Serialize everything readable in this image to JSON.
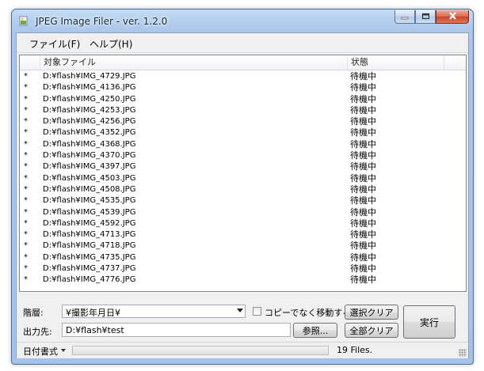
{
  "window": {
    "title": "JPEG Image Filer - ver. 1.2.0"
  },
  "menu": {
    "file": "ファイル(F)",
    "help": "ヘルプ(H)"
  },
  "list": {
    "columns": [
      "対象ファイル",
      "状態"
    ],
    "rows": [
      {
        "mark": "*",
        "file": "D:¥flash¥IMG_4729.JPG",
        "status": "待機中"
      },
      {
        "mark": "*",
        "file": "D:¥flash¥IMG_4136.JPG",
        "status": "待機中"
      },
      {
        "mark": "*",
        "file": "D:¥flash¥IMG_4250.JPG",
        "status": "待機中"
      },
      {
        "mark": "*",
        "file": "D:¥flash¥IMG_4253.JPG",
        "status": "待機中"
      },
      {
        "mark": "*",
        "file": "D:¥flash¥IMG_4256.JPG",
        "status": "待機中"
      },
      {
        "mark": "*",
        "file": "D:¥flash¥IMG_4352.JPG",
        "status": "待機中"
      },
      {
        "mark": "*",
        "file": "D:¥flash¥IMG_4368.JPG",
        "status": "待機中"
      },
      {
        "mark": "*",
        "file": "D:¥flash¥IMG_4370.JPG",
        "status": "待機中"
      },
      {
        "mark": "*",
        "file": "D:¥flash¥IMG_4397.JPG",
        "status": "待機中"
      },
      {
        "mark": "*",
        "file": "D:¥flash¥IMG_4503.JPG",
        "status": "待機中"
      },
      {
        "mark": "*",
        "file": "D:¥flash¥IMG_4508.JPG",
        "status": "待機中"
      },
      {
        "mark": "*",
        "file": "D:¥flash¥IMG_4535.JPG",
        "status": "待機中"
      },
      {
        "mark": "*",
        "file": "D:¥flash¥IMG_4539.JPG",
        "status": "待機中"
      },
      {
        "mark": "*",
        "file": "D:¥flash¥IMG_4592.JPG",
        "status": "待機中"
      },
      {
        "mark": "*",
        "file": "D:¥flash¥IMG_4713.JPG",
        "status": "待機中"
      },
      {
        "mark": "*",
        "file": "D:¥flash¥IMG_4718.JPG",
        "status": "待機中"
      },
      {
        "mark": "*",
        "file": "D:¥flash¥IMG_4735.JPG",
        "status": "待機中"
      },
      {
        "mark": "*",
        "file": "D:¥flash¥IMG_4737.JPG",
        "status": "待機中"
      },
      {
        "mark": "*",
        "file": "D:¥flash¥IMG_4776.JPG",
        "status": "待機中"
      }
    ]
  },
  "form": {
    "hierarchy_label": "階層:",
    "hierarchy_value": "¥撮影年月日¥",
    "move_checkbox_label": "コピーでなく移動する",
    "move_checked": false,
    "output_label": "出力先:",
    "output_value": "D:¥flash¥test",
    "browse_button": "参照...",
    "clear_selected_button": "選択クリア",
    "clear_all_button": "全部クリア",
    "run_button": "実行"
  },
  "status": {
    "date_format": "日付書式",
    "file_count": "19 Files.",
    "progress": 0
  },
  "icons": {
    "app": "image-file-icon",
    "minimize": "minimize-icon",
    "maximize": "maximize-icon",
    "close": "close-icon",
    "dropdown": "chevron-down-icon",
    "resize": "resize-grip-icon"
  }
}
